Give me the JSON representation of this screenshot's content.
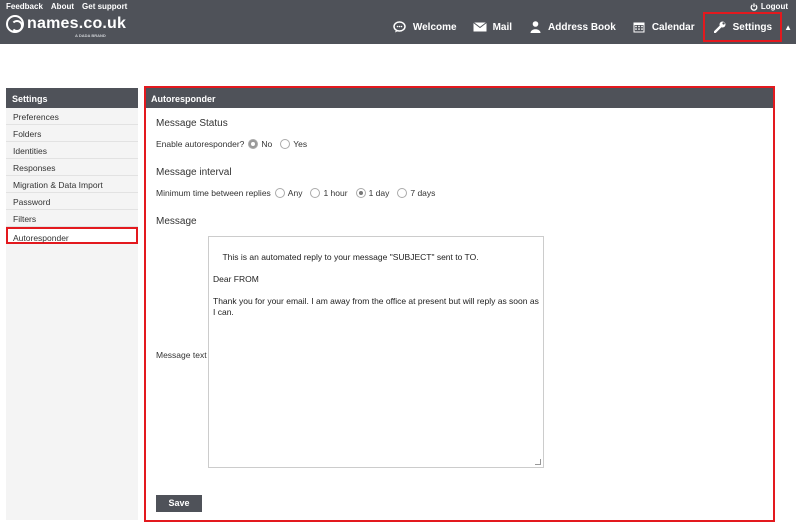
{
  "header": {
    "top_links": [
      "Feedback",
      "About",
      "Get support"
    ],
    "logout": "Logout",
    "logo_text": "names.co.uk",
    "logo_sub": "A DADA BRAND",
    "nav": [
      {
        "label": "Welcome",
        "icon": "chat-bubble-icon"
      },
      {
        "label": "Mail",
        "icon": "envelope-icon"
      },
      {
        "label": "Address Book",
        "icon": "person-icon"
      },
      {
        "label": "Calendar",
        "icon": "calendar-icon"
      },
      {
        "label": "Settings",
        "icon": "wrench-icon"
      }
    ]
  },
  "sidebar": {
    "title": "Settings",
    "items": [
      "Preferences",
      "Folders",
      "Identities",
      "Responses",
      "Migration & Data Import",
      "Password",
      "Filters",
      "Autoresponder"
    ]
  },
  "panel": {
    "title": "Autoresponder",
    "status_title": "Message Status",
    "enable_label": "Enable autoresponder?",
    "enable_options": [
      "No",
      "Yes"
    ],
    "interval_title": "Message interval",
    "interval_label": "Minimum time between replies",
    "interval_options": [
      "Any",
      "1 hour",
      "1 day",
      "7 days"
    ],
    "message_title": "Message",
    "message_label": "Message text",
    "message_text": "This is an automated reply to your message \"SUBJECT\" sent to TO.\n\nDear FROM\n\nThank you for your email. I am away from the office at present but will reply as soon as I can.",
    "save_label": "Save"
  },
  "colors": {
    "header_bg": "#4f5259",
    "highlight": "#e3191e"
  }
}
